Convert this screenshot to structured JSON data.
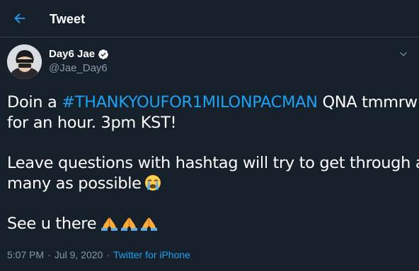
{
  "header": {
    "title": "Tweet",
    "back_icon": "arrow-left-icon",
    "accent_color": "#1da1f2"
  },
  "tweet": {
    "author": {
      "display_name": "Day6 Jae",
      "handle": "@Jae_Day6",
      "verified": true
    },
    "text": {
      "line1_prefix": "Doin a ",
      "line1_hashtag": "#THANKYOUFOR1MILONPACMAN",
      "line1_suffix": " QNA tmmrw",
      "line2": "for an hour. 3pm KST!",
      "line3": "Leave questions with hashtag will try to get through as",
      "line4": "many as possible",
      "line4_emoji": "😭",
      "line5": "See u there",
      "line5_emoji": "🙏🙏🙏"
    },
    "meta": {
      "time": "5:07 PM",
      "separator": "·",
      "date": "Jul 9, 2020",
      "source": "Twitter for iPhone"
    }
  },
  "colors": {
    "background": "#15202b",
    "border": "#38444d",
    "secondary_text": "#8899a6",
    "link": "#1da1f2"
  }
}
